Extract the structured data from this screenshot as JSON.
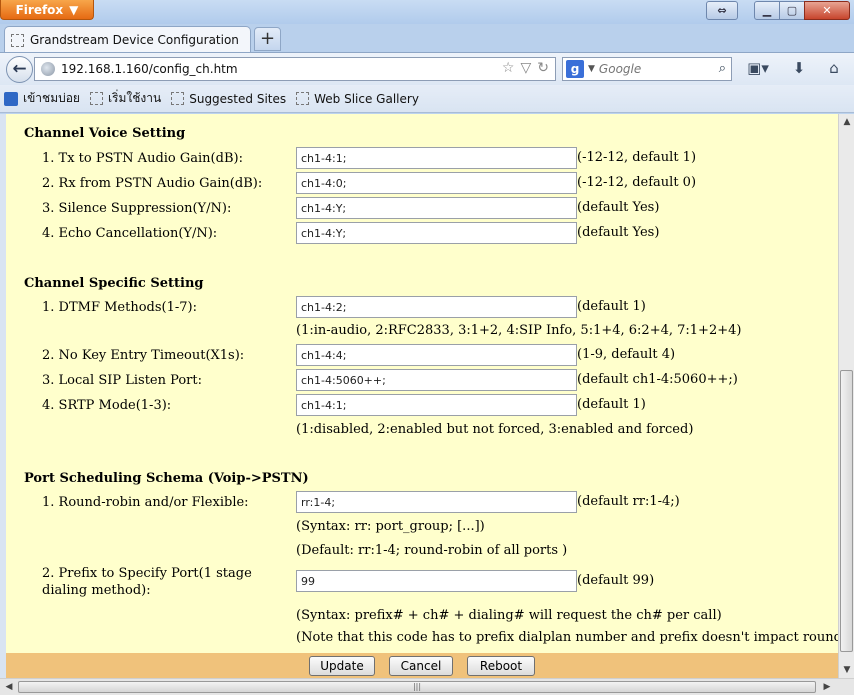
{
  "browser": {
    "app_button": "Firefox",
    "tab_title": "Grandstream Device Configuration",
    "new_tab": "+",
    "url": "192.168.1.160/config_ch.htm",
    "search_placeholder": "Google",
    "search_engine": "g",
    "bookmarks": [
      "เข้าชมบ่อย",
      "เริ่มใช้งาน",
      "Suggested Sites",
      "Web Slice Gallery"
    ]
  },
  "sections": {
    "voice": {
      "title": "Channel Voice Setting",
      "rows": [
        {
          "label": "1. Tx to PSTN Audio Gain(dB):",
          "value": "ch1-4:1;",
          "hint": "(-12-12, default 1)"
        },
        {
          "label": "2. Rx from PSTN Audio Gain(dB):",
          "value": "ch1-4:0;",
          "hint": "(-12-12, default 0)"
        },
        {
          "label": "3. Silence Suppression(Y/N):",
          "value": "ch1-4:Y;",
          "hint": "(default Yes)"
        },
        {
          "label": "4. Echo Cancellation(Y/N):",
          "value": "ch1-4:Y;",
          "hint": "(default Yes)"
        }
      ]
    },
    "specific": {
      "title": "Channel Specific Setting",
      "rows": [
        {
          "label": "1. DTMF Methods(1-7):",
          "value": "ch1-4:2;",
          "hint": "(default 1)",
          "note": "(1:in-audio, 2:RFC2833, 3:1+2, 4:SIP Info, 5:1+4, 6:2+4, 7:1+2+4)"
        },
        {
          "label": "2. No Key Entry Timeout(X1s):",
          "value": "ch1-4:4;",
          "hint": "(1-9, default 4)"
        },
        {
          "label": "3. Local SIP Listen Port:",
          "value": "ch1-4:5060++;",
          "hint": "(default ch1-4:5060++;)"
        },
        {
          "label": "4. SRTP Mode(1-3):",
          "value": "ch1-4:1;",
          "hint": "(default 1)",
          "note": "(1:disabled, 2:enabled but not forced, 3:enabled and forced)"
        }
      ]
    },
    "port": {
      "title": "Port Scheduling Schema (Voip->PSTN)",
      "rows": [
        {
          "label": "1. Round-robin and/or Flexible:",
          "value": "rr:1-4;",
          "hint": "(default rr:1-4;)",
          "note": "(Syntax: rr: port_group; [...])",
          "note2": "(Default: rr:1-4; round-robin of all ports )"
        },
        {
          "label": "2. Prefix to Specify Port(1 stage dialing method):",
          "value": "99",
          "hint": "(default 99)",
          "note": "(Syntax: prefix# + ch# + dialing# will request the ch# per call)",
          "note2": "(Note that this code has to prefix dialplan number and prefix doesn't impact round-robin)"
        }
      ]
    }
  },
  "actions": {
    "update": "Update",
    "cancel": "Cancel",
    "reboot": "Reboot"
  },
  "icons": {
    "back": "arrow-left-icon",
    "star": "star-icon",
    "reload": "reload-icon",
    "search": "magnifier-icon",
    "bookmarks": "bookmarks-icon",
    "download": "download-arrow-icon",
    "home": "home-icon"
  }
}
